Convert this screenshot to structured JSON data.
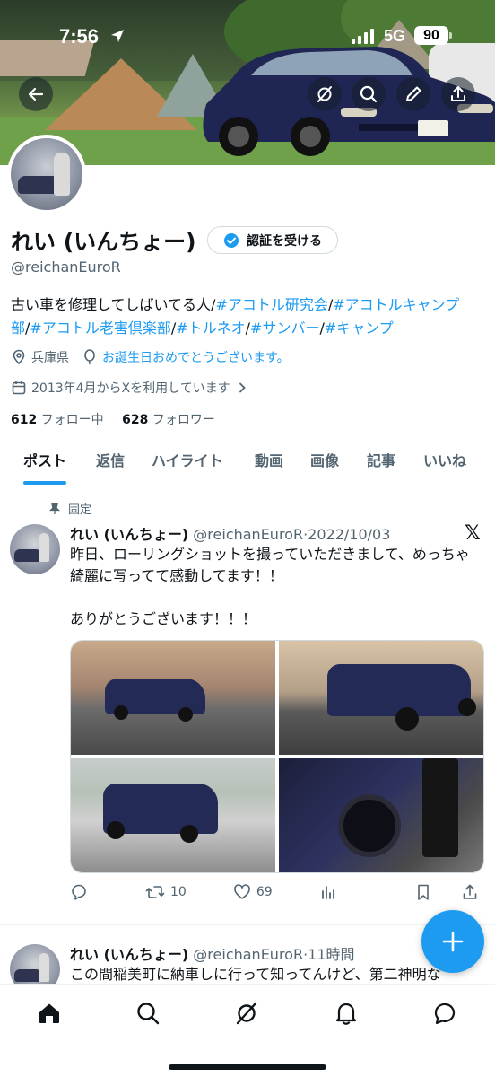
{
  "status_bar": {
    "time": "7:56",
    "network": "5G",
    "battery": "90"
  },
  "profile": {
    "display_name": "れい (いんちょー)",
    "verify_button": "認証を受ける",
    "handle": "@reichanEuroR",
    "bio_parts": [
      {
        "text": "古い車を修理してしばいてる人/",
        "tag": false
      },
      {
        "text": "#アコトル研究会",
        "tag": true
      },
      {
        "text": "/",
        "tag": false
      },
      {
        "text": "#アコトルキャンプ部",
        "tag": true
      },
      {
        "text": "/",
        "tag": false
      },
      {
        "text": "#アコトル老害倶楽部",
        "tag": true
      },
      {
        "text": "/",
        "tag": false
      },
      {
        "text": "#トルネオ",
        "tag": true
      },
      {
        "text": "/",
        "tag": false
      },
      {
        "text": "#サンバー",
        "tag": true
      },
      {
        "text": "/",
        "tag": false
      },
      {
        "text": "#キャンプ",
        "tag": true
      }
    ],
    "location": "兵庫県",
    "birthday": "お誕生日おめでとうございます。",
    "joined": "2013年4月からXを利用しています",
    "following_count": "612",
    "following_label": "フォロー中",
    "followers_count": "628",
    "followers_label": "フォロワー"
  },
  "tabs": [
    "ポスト",
    "返信",
    "ハイライト",
    "動画",
    "画像",
    "記事",
    "いいね"
  ],
  "pinned_tweet": {
    "pinned_label": "固定",
    "name": "れい (いんちょー)",
    "handle": "@reichanEuroR",
    "separator": "·",
    "date": "2022/10/03",
    "text": "昨日、ローリングショットを撮っていただきまして、めっちゃ綺麗に写ってて感動してます！！\n\nありがとうございます！！！",
    "retweets": "10",
    "likes": "69"
  },
  "second_tweet": {
    "name": "れい (いんちょー)",
    "handle": "@reichanEuroR",
    "separator": "·",
    "time": "11時間",
    "text": "この間稲美町に納車しに行って知ってんけど、第二神明な"
  },
  "colors": {
    "accent": "#1d9bf0",
    "text": "#0f1419",
    "muted": "#536471"
  }
}
